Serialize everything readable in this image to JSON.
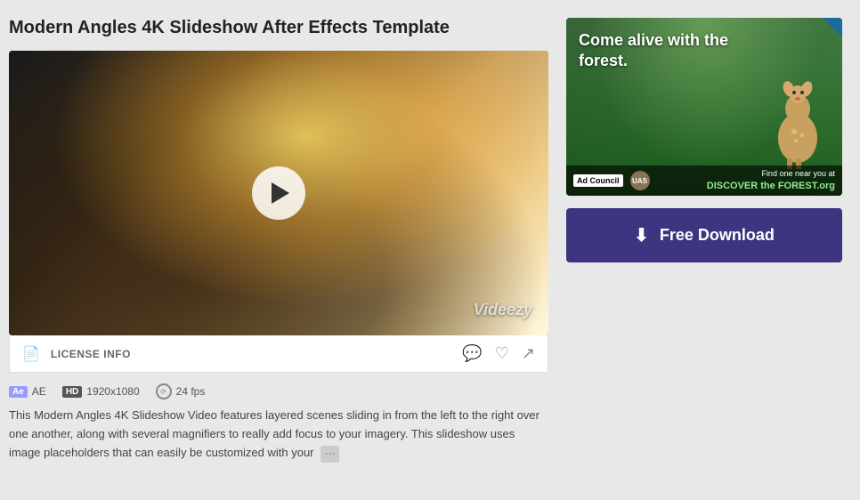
{
  "page": {
    "title": "Modern Angles 4K Slideshow After Effects Template"
  },
  "video": {
    "watermark": "Videezy",
    "play_button_label": "Play"
  },
  "license": {
    "label": "LICENSE INFO"
  },
  "actions": {
    "comment_icon": "comment",
    "like_icon": "heart",
    "share_icon": "share"
  },
  "meta": {
    "ae_badge": "Ae",
    "ae_label": "AE",
    "hd_badge": "HD",
    "resolution": "1920x1080",
    "fps": "24 fps"
  },
  "description": {
    "text": "This Modern Angles 4K Slideshow Video features layered scenes sliding in from the left to the right over one another, along with several magnifiers to really add focus to your imagery. This slideshow uses image placeholders that can easily be customized with your",
    "more_label": "···"
  },
  "ad": {
    "headline": "Come alive with the forest.",
    "logo": "Ad Council",
    "seal_label": "UAS",
    "discover_prefix": "Find one near you at",
    "discover_brand": "DISCOVER the FOREST.org"
  },
  "download_button": {
    "label": "Free Download",
    "icon": "⬇"
  }
}
